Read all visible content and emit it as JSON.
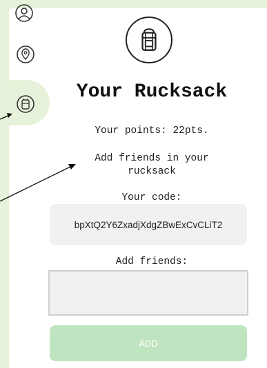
{
  "page": {
    "title": "Your Rucksack",
    "points_text": "Your points: 22pts.",
    "add_friends_hint": "Add friends in your rucksack",
    "your_code_label": "Your code:",
    "code_value": "bpXtQ2Y6ZxadjXdgZBwExCvCLiT2",
    "add_friends_label": "Add friends:",
    "add_button_label": "ADD",
    "friends_input_value": ""
  },
  "sidebar": {
    "items": [
      {
        "icon": "profile-icon",
        "active": false
      },
      {
        "icon": "location-pin-icon",
        "active": false
      },
      {
        "icon": "rucksack-icon",
        "active": true
      }
    ]
  },
  "colors": {
    "background_green": "#e6f2da",
    "button_green": "#bfe5c0",
    "code_box": "#f1f1f1"
  }
}
